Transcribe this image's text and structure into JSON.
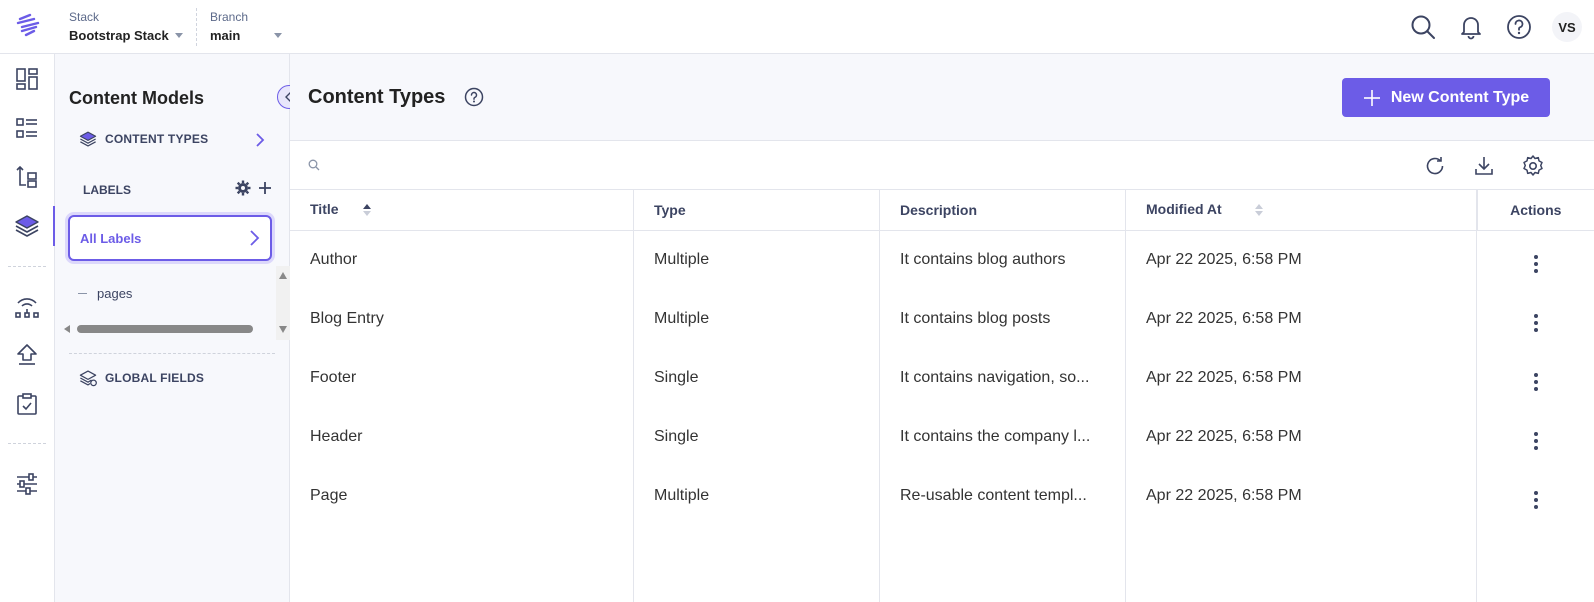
{
  "header": {
    "stack_label": "Stack",
    "stack_value": "Bootstrap Stack",
    "branch_label": "Branch",
    "branch_value": "main",
    "avatar_initials": "VS"
  },
  "rail": {
    "icons": [
      "dashboard-icon",
      "entries-list-icon",
      "content-tree-icon",
      "content-models-icon",
      "releases-icon",
      "deploy-icon",
      "tasks-icon",
      "settings-sliders-icon"
    ]
  },
  "sidebar": {
    "title": "Content Models",
    "content_types_label": "CONTENT TYPES",
    "labels_heading": "LABELS",
    "all_labels": "All Labels",
    "label_items": [
      "pages"
    ],
    "global_fields_label": "GLOBAL FIELDS"
  },
  "main": {
    "title": "Content Types",
    "new_button_label": "New Content Type",
    "search_placeholder": "",
    "columns": [
      "Title",
      "Type",
      "Description",
      "Modified At",
      "Actions"
    ],
    "rows": [
      {
        "title": "Author",
        "type": "Multiple",
        "description": "It contains blog authors",
        "modified": "Apr 22 2025, 6:58 PM"
      },
      {
        "title": "Blog Entry",
        "type": "Multiple",
        "description": "It contains blog posts",
        "modified": "Apr 22 2025, 6:58 PM"
      },
      {
        "title": "Footer",
        "type": "Single",
        "description": "It contains navigation, so...",
        "modified": "Apr 22 2025, 6:58 PM"
      },
      {
        "title": "Header",
        "type": "Single",
        "description": "It contains the company l...",
        "modified": "Apr 22 2025, 6:58 PM"
      },
      {
        "title": "Page",
        "type": "Multiple",
        "description": "Re-usable content templ...",
        "modified": "Apr 22 2025, 6:58 PM"
      }
    ]
  },
  "colors": {
    "accent": "#6c5ce7",
    "text_dark": "#222222",
    "text_muted": "#3c4462",
    "border": "#e3e5ec",
    "panel_bg": "#f7f8fc"
  }
}
